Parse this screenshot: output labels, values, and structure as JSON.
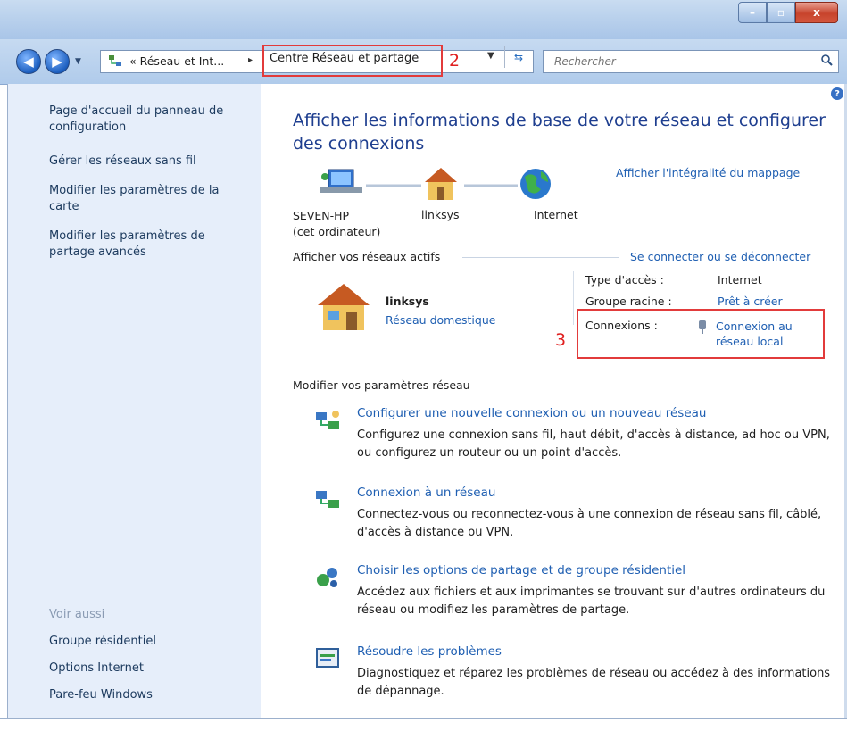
{
  "window": {
    "minimize": "–",
    "maximize": "▫",
    "close": "x"
  },
  "address": {
    "back": "◀",
    "forward": "▶",
    "breadcrumb_parent": "« Réseau et Int...",
    "separator": "▸",
    "breadcrumb_current": "Centre Réseau et partage",
    "annotation": "2",
    "search_placeholder": "Rechercher"
  },
  "sidebar": {
    "items": [
      "Page d'accueil du panneau de configuration",
      "Gérer les réseaux sans fil",
      "Modifier les paramètres de la carte",
      "Modifier les paramètres de partage avancés"
    ],
    "see_also": "Voir aussi",
    "see_also_items": [
      "Groupe résidentiel",
      "Options Internet",
      "Pare-feu Windows"
    ]
  },
  "main": {
    "title": "Afficher les informations de base de votre réseau et configurer des connexions",
    "map_link": "Afficher l'intégralité du mappage",
    "nodes": [
      {
        "label": "SEVEN-HP",
        "sub": "(cet ordinateur)"
      },
      {
        "label": "linksys",
        "sub": ""
      },
      {
        "label": "Internet",
        "sub": ""
      }
    ],
    "active_heading": "Afficher vos réseaux actifs",
    "connect_link": "Se connecter ou se déconnecter",
    "network_name": "linksys",
    "network_type": "Réseau domestique",
    "access_label": "Type d'accès :",
    "access_value": "Internet",
    "homegroup_label": "Groupe racine :",
    "homegroup_value": "Prêt à créer",
    "conn_label": "Connexions :",
    "conn_value_1": "Connexion au",
    "conn_value_2": "réseau local",
    "annotation": "3",
    "settings_heading": "Modifier vos paramètres réseau",
    "tasks": [
      {
        "title": "Configurer une nouvelle connexion ou un nouveau réseau",
        "desc": "Configurez une connexion sans fil, haut débit, d'accès à distance, ad hoc ou VPN, ou configurez un routeur ou un point d'accès."
      },
      {
        "title": "Connexion à un réseau",
        "desc": "Connectez-vous ou reconnectez-vous à une connexion de réseau sans fil, câblé, d'accès à distance ou VPN."
      },
      {
        "title": "Choisir les options de partage et de groupe résidentiel",
        "desc": "Accédez aux fichiers et aux imprimantes se trouvant sur d'autres ordinateurs du réseau ou modifiez les paramètres de partage."
      },
      {
        "title": "Résoudre les problèmes",
        "desc": "Diagnostiquez et réparez les problèmes de réseau ou accédez à des informations de dépannage."
      }
    ]
  },
  "colors": {
    "link": "#1f5fb2",
    "title": "#1e3e8f",
    "annotation": "#e02020",
    "sidebar_bg": "#e6eefa"
  }
}
